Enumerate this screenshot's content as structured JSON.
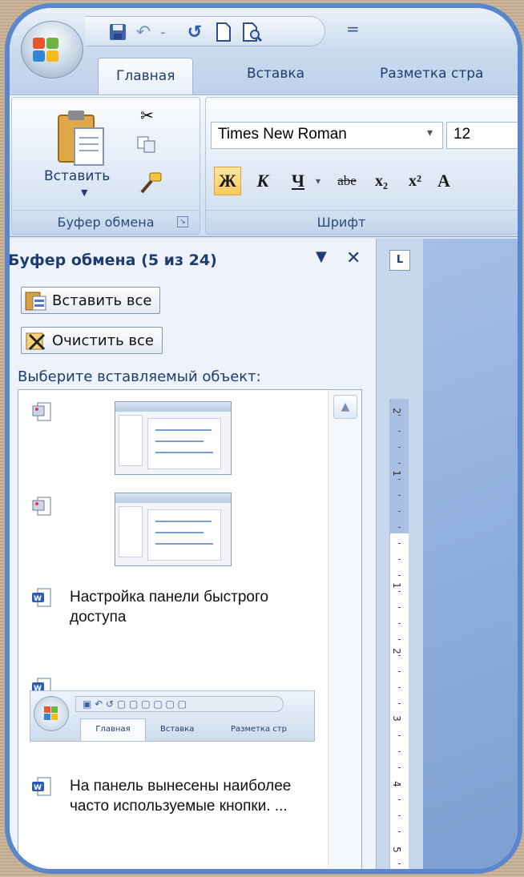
{
  "qat": {
    "more": "="
  },
  "tabs": [
    "Главная",
    "Вставка",
    "Разметка стра"
  ],
  "ribbon": {
    "paste_label": "Вставить",
    "clipboard_group": "Буфер обмена",
    "font_group": "Шрифт",
    "font_name": "Times New Roman",
    "font_size": "12",
    "format_buttons": [
      "Ж",
      "К",
      "Ч",
      "abe",
      "x₂",
      "x²",
      "A"
    ]
  },
  "pane": {
    "title": "Буфер обмена",
    "count": "(5 из 24)",
    "paste_all": "Вставить все",
    "clear_all": "Очистить все",
    "choose_label": "Выберите вставляемый объект:",
    "items": [
      {
        "type": "image"
      },
      {
        "type": "image"
      },
      {
        "type": "text",
        "text": "Настройка панели быстрого доступа"
      },
      {
        "type": "image-qat",
        "tabs": [
          "Главная",
          "Вставка",
          "Разметка стр"
        ]
      },
      {
        "type": "text",
        "text": "На панель вынесены наиболее часто используемые кнопки. ..."
      }
    ]
  },
  "ruler": {
    "corner": "L",
    "numbers": [
      "2",
      "1",
      "1",
      "2",
      "3",
      "4",
      "5"
    ]
  },
  "colors": {
    "frame": "#5a86cc",
    "ribbon": "#dde8f6",
    "document": "#8eaedc"
  }
}
